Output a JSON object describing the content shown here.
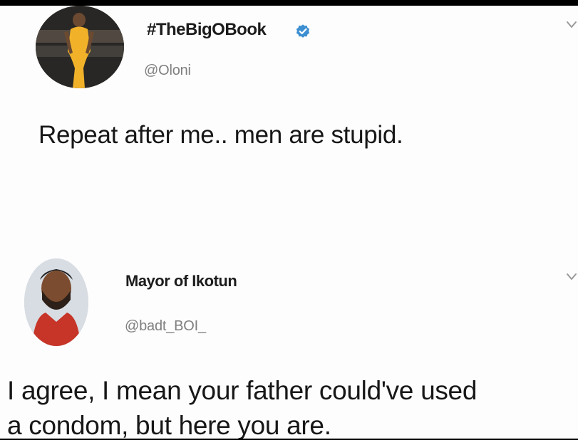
{
  "colors": {
    "card_background": "#fdfdfd",
    "outer_background": "#000000",
    "text": "#171717",
    "secondary_text": "#7f7f7f",
    "verified_blue": "#3d8fd1"
  },
  "tweet_1": {
    "display_name": "#TheBigOBook",
    "username": "@Oloni",
    "text": "Repeat after me.. men are stupid.",
    "verified_icon": "verified-badge-icon",
    "menu_icon": "chevron-down-icon"
  },
  "tweet_2": {
    "display_name": "Mayor of Ikotun",
    "username": "@badt_BOI_",
    "text_line_1": "I agree, I mean your father could've used",
    "text_line_2": "a condom, but here you are.",
    "menu_icon": "chevron-down-icon"
  }
}
